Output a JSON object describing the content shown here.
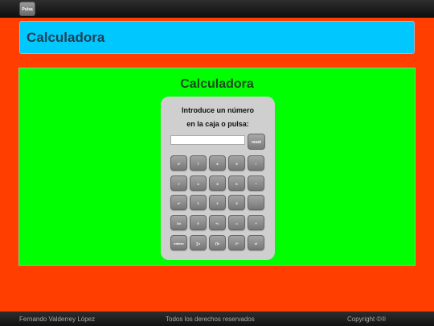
{
  "topbar": {
    "button_label": "Pulsa"
  },
  "header": {
    "title": "Calculadora"
  },
  "panel": {
    "title": "Calculadora"
  },
  "calculator": {
    "prompt_line1": "Introduce un número",
    "prompt_line2": "en la caja o pulsa:",
    "screen_value": "",
    "reset_label": "reset",
    "rows": [
      [
        "x²",
        "7",
        "8",
        "9",
        "/"
      ],
      [
        "√",
        "4",
        "5",
        "6",
        "*"
      ],
      [
        "x³",
        "1",
        "2",
        "3",
        "-"
      ],
      [
        "1/x",
        "0",
        "+/-",
        "=",
        "+"
      ],
      [
        "entero",
        "∑x",
        "∏x",
        "2ⁿ",
        "x!"
      ]
    ]
  },
  "footer": {
    "author": "Fernando Valderrey López",
    "rights": "Todos los derechos reservados",
    "copyright": "Copyright ©®"
  }
}
